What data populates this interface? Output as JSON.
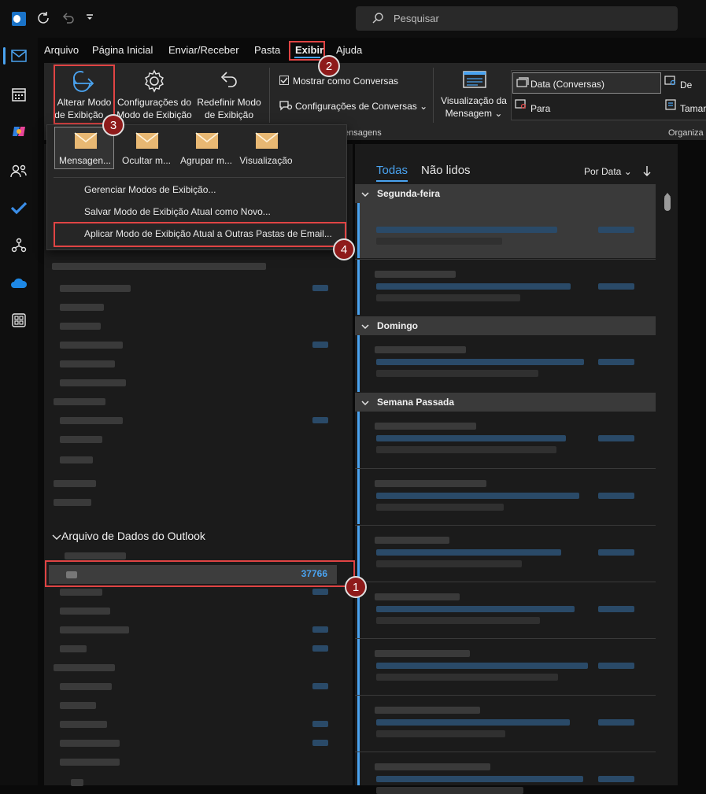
{
  "search": {
    "placeholder": "Pesquisar"
  },
  "menu": [
    "Arquivo",
    "Página Inicial",
    "Enviar/Receber",
    "Pasta",
    "Exibir",
    "Ajuda"
  ],
  "ribbon": {
    "change_view": [
      "Alterar Modo",
      "de Exibição"
    ],
    "view_settings": [
      "Configurações do",
      "Modo de Exibição"
    ],
    "reset_view": [
      "Redefinir Modo",
      "de Exibição"
    ],
    "show_as_conversations": "Mostrar como Conversas",
    "conversation_settings": "Configurações de Conversas",
    "group_label": "ensagens",
    "message_preview": [
      "Visualização da",
      "Mensagem"
    ],
    "sort_date": "Data (Conversas)",
    "sort_from": "De",
    "sort_to": "Para",
    "sort_size": "Tamar",
    "arrange_label": "Organiza"
  },
  "dropdown": {
    "views": [
      "Mensagen...",
      "Ocultar m...",
      "Agrupar m...",
      "Visualização"
    ],
    "items": [
      "Gerenciar Modos de Exibição...",
      "Salvar Modo de Exibição Atual como Novo...",
      "Aplicar Modo de Exibição Atual a Outras Pastas de Email..."
    ]
  },
  "folders": {
    "data_file": "Arquivo de Dados do Outlook",
    "selected_count": "37766"
  },
  "msglist": {
    "tab_all": "Todas",
    "tab_unread": "Não lidos",
    "sort": "Por Data",
    "groups": [
      "Segunda-feira",
      "Domingo",
      "Semana Passada"
    ]
  },
  "badges": [
    "1",
    "2",
    "3",
    "4"
  ],
  "colors": {
    "accent": "#4aa3f0",
    "highlight": "#e04444",
    "badge": "#8e1a1a"
  }
}
